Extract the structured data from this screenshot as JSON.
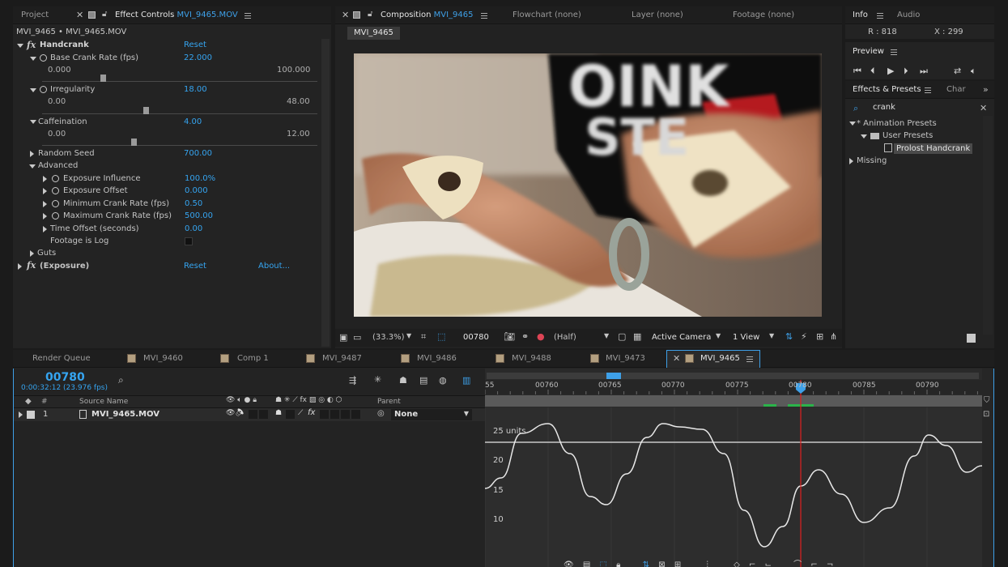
{
  "colors": {
    "accent": "#35a4f0",
    "panel_bg": "#232323",
    "tabbar_bg": "#1e1e1e",
    "playhead": "#e02020",
    "curve": "#e8e8e8"
  },
  "effect_panel": {
    "tab_project": "Project",
    "tab_effect_controls_prefix": "Effect Controls",
    "tab_effect_controls_file": "MVI_9465.MOV",
    "breadcrumb": "MVI_9465 • MVI_9465.MOV",
    "effect_name": "Handcrank",
    "reset": "Reset",
    "params": [
      {
        "label": "Base Crank Rate (fps)",
        "value": "22.000",
        "min": "0.000",
        "max": "100.000",
        "fraction": 0.22
      },
      {
        "label": "Irregularity",
        "value": "18.00",
        "min": "0.00",
        "max": "48.00",
        "fraction": 0.375
      },
      {
        "label": "Caffeination",
        "value": "4.00",
        "min": "0.00",
        "max": "12.00",
        "fraction": 0.333
      }
    ],
    "random_seed_label": "Random Seed",
    "random_seed_value": "700.00",
    "advanced_label": "Advanced",
    "advanced": [
      {
        "label": "Exposure Influence",
        "value": "100.0%"
      },
      {
        "label": "Exposure Offset",
        "value": "0.000"
      },
      {
        "label": "Minimum Crank Rate (fps)",
        "value": "0.50"
      },
      {
        "label": "Maximum Crank Rate (fps)",
        "value": "500.00"
      },
      {
        "label": "Time Offset (seconds)",
        "value": "0.00"
      }
    ],
    "footage_log_label": "Footage is Log",
    "guts_label": "Guts",
    "exposure_label": "(Exposure)",
    "exposure_reset": "Reset",
    "about": "About..."
  },
  "comp_panel": {
    "tab_composition_prefix": "Composition",
    "tab_composition_name": "MVI_9465",
    "tab_flowchart": "Flowchart (none)",
    "tab_layer": "Layer (none)",
    "tab_footage": "Footage (none)",
    "comp_label": "MVI_9465",
    "zoom": "(33.3%)",
    "timecode": "00780",
    "resolution": "(Half)",
    "camera": "Active Camera",
    "view": "1 View"
  },
  "photo": {
    "shirt_text_line1": "OINK",
    "shirt_text_line2": "STE"
  },
  "info_panel": {
    "tab_info": "Info",
    "tab_audio": "Audio",
    "r_value": "R : 818",
    "x_value": "X : 299",
    "preview_label": "Preview"
  },
  "effects_presets": {
    "tab_label": "Effects & Presets",
    "tab_char": "Char",
    "search_value": "crank",
    "animation_presets": "* Animation Presets",
    "user_presets": "User Presets",
    "preset_item": "Prolost Handcrank",
    "missing": "Missing"
  },
  "timeline": {
    "tabs": [
      "Render Queue",
      "MVI_9460",
      "Comp 1",
      "MVI_9487",
      "MVI_9486",
      "MVI_9488",
      "MVI_9473",
      "MVI_9465"
    ],
    "current_frame": "00780",
    "current_time": "0:00:32:12 (23.976 fps)",
    "col_hash": "#",
    "col_source": "Source Name",
    "col_parent": "Parent",
    "layer_index": "1",
    "layer_name": "MVI_9465.MOV",
    "parent_value": "None",
    "ruler_labels": [
      "55",
      "00760",
      "00765",
      "00770",
      "00775",
      "00780",
      "00785",
      "00790"
    ],
    "graph_units_label": "25 units",
    "graph_ticks": [
      "20",
      "15",
      "10"
    ]
  }
}
